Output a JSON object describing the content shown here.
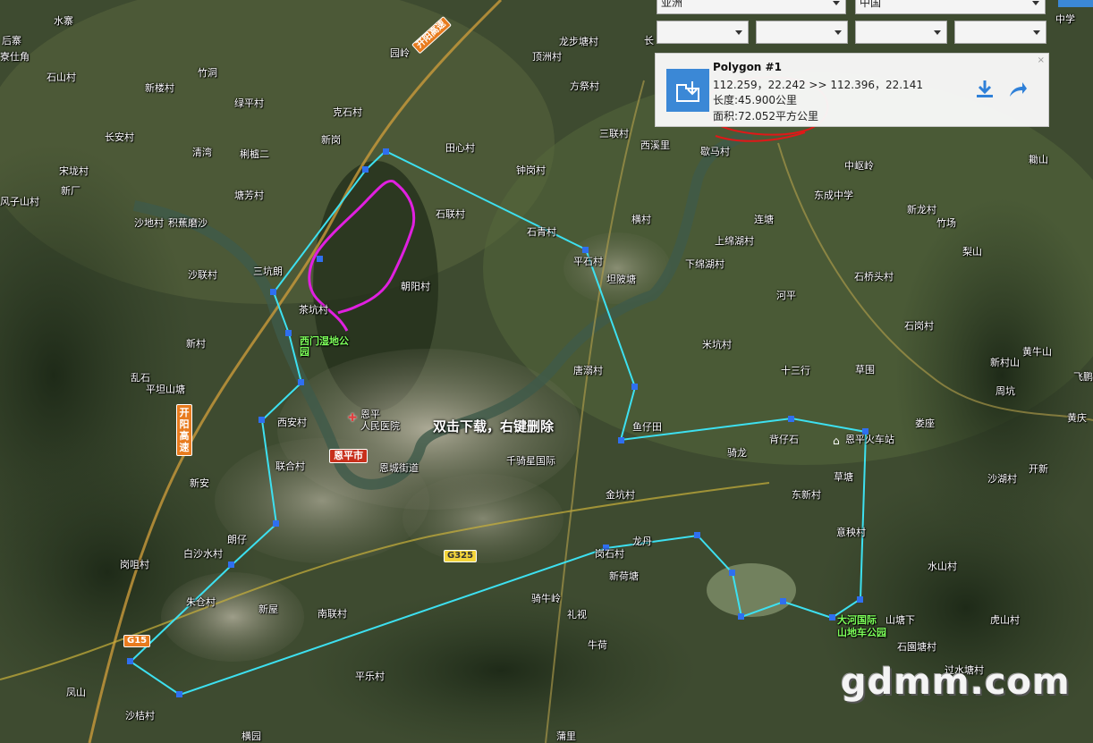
{
  "map_labels": {
    "shuizhai": "水寨",
    "houzhai": "后寨",
    "shitianjiao": "寮仕角",
    "shishancun": "石山村",
    "zhudong": "竹洞",
    "xinloucun": "新楼村",
    "lvpingcun": "绿平村",
    "kezhuangcun": "克石村",
    "yuanling": "园岭",
    "longbutang": "龙步塘村",
    "dingtongcun": "顶洲村",
    "fangcaicun": "方祭村",
    "chang": "长",
    "zhongxue": "中学",
    "changancun": "长安村",
    "qingwan": "清湾",
    "zhangbaer": "梸樝二",
    "xingang": "新岗",
    "tianxincun": "田心村",
    "sanlicun": "三联村",
    "xixili": "西溪里",
    "xiebiaocun": "歇马村",
    "kangong": "勘工",
    "moshan": "耡山",
    "songyancun": "宋垅村",
    "xinchang": "新厂",
    "fengzishancun": "风子山村",
    "tangfangcun": "塘芳村",
    "shadicun": "沙地村",
    "jiaolimoisha": "积蕉磨沙",
    "zhongdu": "钟岗村",
    "shilicun": "石联村",
    "shiqing": "石青村",
    "zhongdaoling": "中岖岭",
    "dongchengzhongxue": "东成中学",
    "xinlongcun": "新龙村",
    "zhuchang": "竹场",
    "lishan": "梨山",
    "mengcun": "横村",
    "shangmiehu": "上绵湖村",
    "liantang": "连塘",
    "shazhengcun": "沙联村",
    "sankengliang": "三坑朗",
    "chaoyangcun": "朝阳村",
    "pinggangcun": "平石村",
    "kunchangtang": "坦陂塘",
    "xiamiehu": "下绵湖村",
    "heping": "河平",
    "shiqiaotou": "石桥头村",
    "chakengcun": "茶坑村",
    "ximenwetland": "西门湿地公园",
    "xincun": "新村",
    "shigangcun": "石岗村",
    "mijiangcun": "米坑村",
    "shisanhang": "十三行",
    "caowei": "草围",
    "huangniushan": "黄牛山",
    "xincunshan": "新村山",
    "zhoukeng": "周坑",
    "luoshi": "乱石",
    "pingtanshan": "平坦山塘",
    "tangyongcun": "唐溺村",
    "feipeng": "飞鹏",
    "enping": "恩平",
    "renminyiyuan": "人民医院",
    "xianshuangcun": "西安村",
    "yuzaitian": "鱼仔田",
    "beizaishi": "背仔石",
    "enpinghuochezhan": "恩平火车站",
    "louzuo": "娄座",
    "huangqing": "黄庆",
    "enpingshi": "恩平市",
    "enchengjiedao": "恩城街道",
    "qianxingguoji": "千骑星国际",
    "lianhecun": "联合村",
    "qilong": "骑龙",
    "kaishan": "开新",
    "shahucun": "沙湖村",
    "xinan": "新安",
    "jinkengcun": "金坑村",
    "dongxincun": "东新村",
    "caotang": "草塘",
    "langzi": "朗仔",
    "baishashuicun": "白沙水村",
    "yilingcun": "意秧村",
    "gangshicun": "岗石村",
    "xinhetang": "新荷塘",
    "longsheng": "龙丹",
    "shuishancun": "水山村",
    "gangyuecun": "岗咀村",
    "jiangcangcun": "朱仓村",
    "xinwu": "新屋",
    "nanliancun": "南联村",
    "qiniuling": "骑牛岭",
    "lishi": "礼视",
    "dahe1": "大河国际",
    "dahe2": "山地车公园",
    "shantangxia": "山塘下",
    "hushancun": "虎山村",
    "shitangweicun": "石園塘村",
    "niuhe": "牛荷",
    "fengshan": "凤山",
    "shajiucun": "沙桔村",
    "pinglecun": "平乐村",
    "hengyuan": "横园",
    "puli": "蒲里",
    "shuitangcun": "过水塘村"
  },
  "road_badges": {
    "kaiyang_top": "开阳高速",
    "kaiyang_left": "开阳高速",
    "g15": "G15",
    "g325": "G325",
    "enping_city": "恩平市"
  },
  "overlay_text": "双击下载，右键删除",
  "watermark": "gdmm.com",
  "top_selects": {
    "continent": "亚洲",
    "country": "中国",
    "sel3": "",
    "sel4": "",
    "sel5": "",
    "sel6": ""
  },
  "info_panel": {
    "title": "Polygon #1",
    "coords": "112.259，22.242 >> 112.396，22.141",
    "length": "长度:45.900公里",
    "area": "面积:72.052平方公里",
    "close": "×"
  },
  "colors": {
    "polygon": "#3de0f0",
    "magenta_path": "#e020e0",
    "red_circle": "#e01818",
    "panel_icon": "#3b88d6"
  },
  "icons": {
    "download": "download-icon",
    "share": "share-icon",
    "location": "location-icon"
  }
}
